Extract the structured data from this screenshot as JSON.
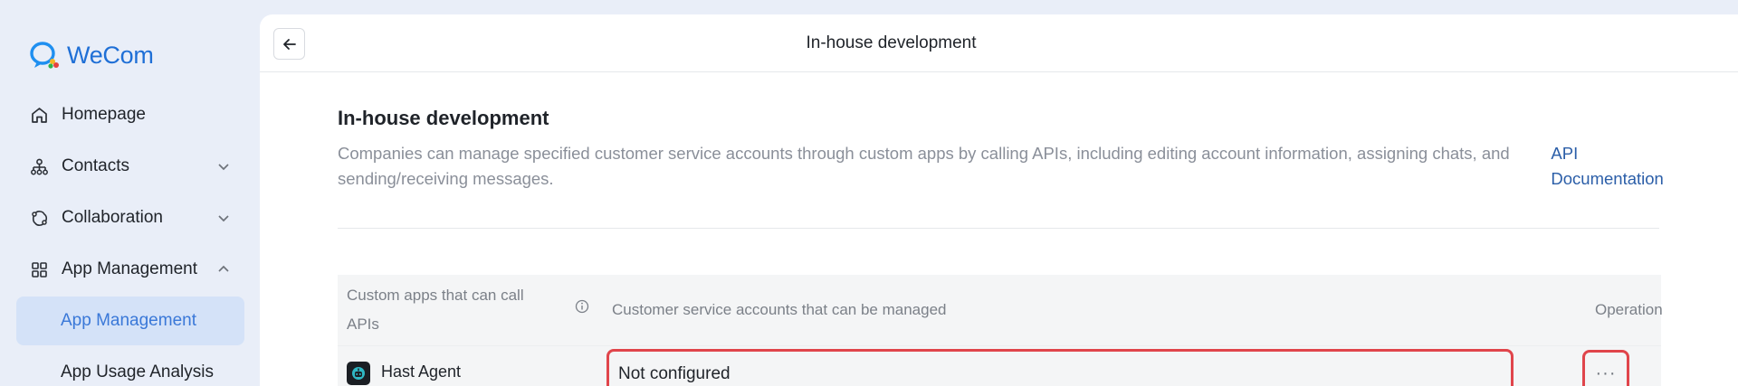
{
  "brand": {
    "name": "WeCom",
    "color": "#1f6fd6"
  },
  "sidebar": {
    "items": [
      {
        "label": "Homepage",
        "icon": "home-icon"
      },
      {
        "label": "Contacts",
        "icon": "org-chart-icon",
        "expandable": true,
        "expanded": false
      },
      {
        "label": "Collaboration",
        "icon": "collaboration-icon",
        "expandable": true,
        "expanded": false
      },
      {
        "label": "App Management",
        "icon": "grid-icon",
        "expandable": true,
        "expanded": true
      }
    ],
    "subitems": [
      {
        "label": "App Management",
        "active": true
      },
      {
        "label": "App Usage Analysis",
        "active": false
      }
    ]
  },
  "header": {
    "title": "In-house development"
  },
  "section": {
    "title": "In-house development",
    "description": "Companies can manage specified customer service accounts through custom apps by calling APIs, including editing account information, assigning chats, and sending/receiving messages.",
    "api_link": "API Documentation"
  },
  "table": {
    "columns": {
      "apps": "Custom apps that can call APIs",
      "accounts": "Customer service accounts that can be managed",
      "operation": "Operation"
    },
    "rows": [
      {
        "app_name": "Hast Agent",
        "accounts": "Not configured",
        "operation": "···"
      }
    ]
  },
  "colors": {
    "accent": "#3a78d8",
    "highlight": "#e0454b",
    "link": "#2b5ea8"
  }
}
